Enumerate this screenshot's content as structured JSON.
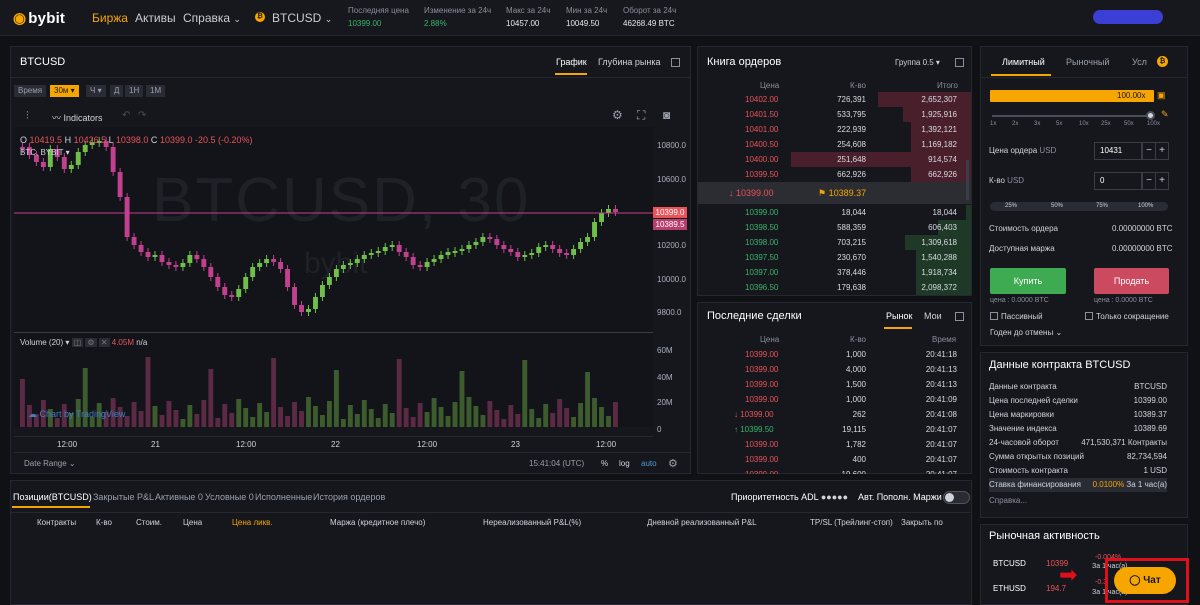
{
  "header": {
    "logo": "bybit",
    "nav": [
      "Биржа",
      "Активы",
      "Справка"
    ],
    "symbol": "BTCUSD",
    "stats": [
      {
        "label": "Последняя цена",
        "value": "10399.00"
      },
      {
        "label": "Изменение за 24ч",
        "value": "2.88%"
      },
      {
        "label": "Макс за 24ч",
        "value": "10457.00"
      },
      {
        "label": "Мин за 24ч",
        "value": "10049.50"
      },
      {
        "label": "Оборот за 24ч",
        "value": "46268.49 BTC"
      }
    ]
  },
  "chart": {
    "title": "BTCUSD",
    "tabs": [
      "График",
      "Глубина рынка"
    ],
    "intervals": [
      "Время",
      "30м",
      "Ч",
      "Д",
      "1Н",
      "1М"
    ],
    "indicators": "Indicators",
    "ohlc": {
      "o_label": "O",
      "o": "10419.5",
      "h_label": "H",
      "h": "10426.5",
      "l_label": "L",
      "l": "10398.0",
      "c_label": "C",
      "c": "10399.0",
      "chg": "-20.5 (-0.20%)"
    },
    "watermark": "BTCUSD, 30",
    "watermark2": "bybit",
    "source": "BTC, BYBIT",
    "price_axis": [
      "10800.0",
      "10600.0",
      "10400.0",
      "10200.0",
      "10000.0",
      "9800.0"
    ],
    "last_price": "10399.0",
    "mark_price": "10389.5",
    "volume_label": "Volume (20)",
    "volume_value": "4.05M",
    "volume_na": "n/a",
    "vol_axis": [
      "60M",
      "40M",
      "20M",
      "0"
    ],
    "time_axis": [
      "12:00",
      "21",
      "12:00",
      "22",
      "12:00",
      "23",
      "12:00"
    ],
    "tv_label": "Chart by TradingView",
    "date_range": "Date Range",
    "clock": "15:41:04 (UTC)",
    "opts": [
      "%",
      "log",
      "auto"
    ]
  },
  "orderbook": {
    "title": "Книга ордеров",
    "grouping": "Группа 0.5",
    "headers": [
      "Цена",
      "К-во",
      "Итого"
    ],
    "asks": [
      [
        "10402.00",
        "726,391",
        "2,652,307",
        0.34
      ],
      [
        "10401.50",
        "533,795",
        "1,925,916",
        0.25
      ],
      [
        "10401.00",
        "222,939",
        "1,392,121",
        0.22
      ],
      [
        "10400.50",
        "254,608",
        "1,169,182",
        0.22
      ],
      [
        "10400.00",
        "251,648",
        "914,574",
        0.66
      ],
      [
        "10399.50",
        "662,926",
        "662,926",
        0.22
      ]
    ],
    "mid_last": "10399.00",
    "mid_mark": "10389.37",
    "bids": [
      [
        "10399.00",
        "18,044",
        "18,044",
        0.02
      ],
      [
        "10398.50",
        "588,359",
        "606,403",
        0.12
      ],
      [
        "10398.00",
        "703,215",
        "1,309,618",
        0.24
      ],
      [
        "10397.50",
        "230,670",
        "1,540,288",
        0.2
      ],
      [
        "10397.00",
        "378,446",
        "1,918,734",
        0.2
      ],
      [
        "10396.50",
        "179,638",
        "2,098,372",
        0.2
      ]
    ]
  },
  "trades": {
    "title": "Последние сделки",
    "tabs": [
      "Рынок",
      "Мои"
    ],
    "headers": [
      "Цена",
      "К-во",
      "Время"
    ],
    "rows": [
      [
        "10399.00",
        "1,000",
        "20:41:18",
        "red",
        ""
      ],
      [
        "10399.00",
        "4,000",
        "20:41:13",
        "red",
        ""
      ],
      [
        "10399.00",
        "1,500",
        "20:41:13",
        "red",
        ""
      ],
      [
        "10399.00",
        "1,000",
        "20:41:09",
        "red",
        ""
      ],
      [
        "10399.00",
        "262",
        "20:41:08",
        "red",
        "down"
      ],
      [
        "10399.50",
        "19,115",
        "20:41:07",
        "green",
        "up"
      ],
      [
        "10399.00",
        "1,782",
        "20:41:07",
        "red",
        ""
      ],
      [
        "10399.00",
        "400",
        "20:41:07",
        "red",
        ""
      ],
      [
        "10399.00",
        "19,600",
        "20:41:07",
        "red",
        ""
      ]
    ]
  },
  "order_form": {
    "tabs": [
      "Лимитный",
      "Рыночный",
      "Усл"
    ],
    "leverage": "100.00x",
    "ticks": [
      "1x",
      "2x",
      "3x",
      "5x",
      "10x",
      "25x",
      "50x",
      "100x"
    ],
    "price_label": "Цена ордера",
    "price_unit": "USD",
    "price_value": "10431",
    "qty_label": "К-во",
    "qty_unit": "USD",
    "qty_value": "0",
    "pcts": [
      "25%",
      "50%",
      "75%",
      "100%"
    ],
    "cost_label": "Стоимость ордера",
    "cost_value": "0.00000000 BTC",
    "margin_label": "Доступная маржа",
    "margin_value": "0.00000000 BTC",
    "buy": "Купить",
    "sell": "Продать",
    "buy_cost": "цена : 0.0000 BTC",
    "sell_cost": "цена : 0.0000 BTC",
    "passive": "Пассивный",
    "reduce": "Только сокращение",
    "tif": "Годен до отмены"
  },
  "contract": {
    "title": "Данные контракта BTCUSD",
    "rows": [
      [
        "Данные контракта",
        "BTCUSD"
      ],
      [
        "Цена последней сделки",
        "10399.00"
      ],
      [
        "Цена маркировки",
        "10389.37"
      ],
      [
        "Значение индекса",
        "10389.69"
      ],
      [
        "24-часовой оборот",
        "471,530,371 Контракты"
      ],
      [
        "Сумма открытых позиций",
        "82,734,594"
      ],
      [
        "Стоимость контракта",
        "1 USD"
      ],
      [
        "Ставка финансирования",
        "0.0100% За 1 час(а)"
      ]
    ],
    "help": "Справка..."
  },
  "market_activity": {
    "title": "Рыночная активность",
    "rows": [
      [
        "BTCUSD",
        "10399",
        "-0.004%",
        "За 1 час(а)"
      ],
      [
        "ETHUSD",
        "194.7",
        "-0.3",
        "За 1 час(а)"
      ]
    ]
  },
  "positions": {
    "tabs": [
      "Позиции(BTCUSD)",
      "Закрытые P&L",
      "Активные 0",
      "Условные 0",
      "Исполненные",
      "История ордеров"
    ],
    "adl": "Приоритетность ADL",
    "auto": "Авт. Пополн. Маржи",
    "headers": [
      "Контракты",
      "К-во",
      "Стоим.",
      "Цена",
      "Цена ликв.",
      "Маржа (кредитное плечо)",
      "Нереализованный P&L(%)",
      "Дневной реализованный P&L",
      "TP/SL (Трейлинг-стоп)",
      "Закрыть по"
    ]
  },
  "chat": {
    "label": "Чат"
  },
  "colors": {
    "accent": "#f7a600",
    "buy": "#3eab52",
    "sell": "#cc4a60",
    "up": "#3cb46e",
    "down": "#e8545a",
    "highlight": "#e0101a"
  }
}
